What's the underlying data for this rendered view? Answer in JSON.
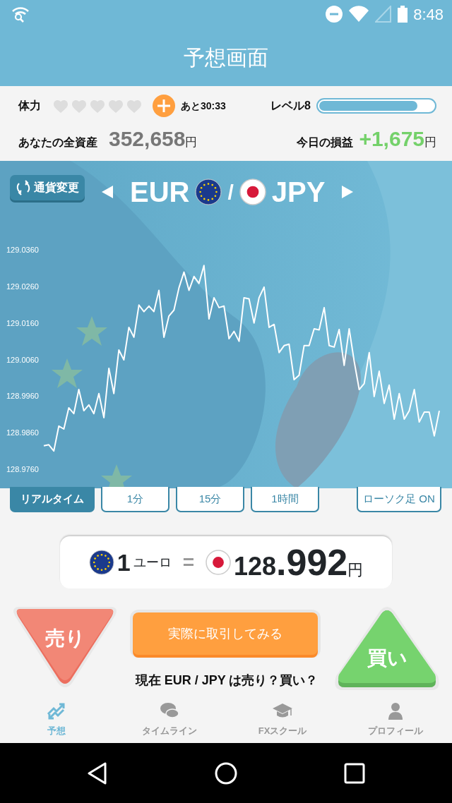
{
  "status_bar": {
    "time": "8:48"
  },
  "header": {
    "title": "予想画面"
  },
  "stamina": {
    "label": "体力",
    "stars": 0,
    "timer": "あと30:33"
  },
  "level": {
    "label": "レベル8",
    "level": 0.86
  },
  "assets": {
    "label": "あなたの全資産",
    "value": "352,658",
    "unit": "円"
  },
  "profit": {
    "label": "今日の損益",
    "value": "+1,675",
    "unit": "円"
  },
  "pair": {
    "change_button": "通貨変更",
    "base": "EUR",
    "separator": "/",
    "quote": "JPY"
  },
  "chart_data": {
    "type": "line",
    "ylim": [
      128.976,
      129.036
    ],
    "yticks": [
      {
        "value": 129.036,
        "label": "129.0360"
      },
      {
        "value": 129.026,
        "label": "129.0260"
      },
      {
        "value": 129.016,
        "label": "129.0160"
      },
      {
        "value": 129.006,
        "label": "129.0060"
      },
      {
        "value": 128.996,
        "label": "128.9960"
      },
      {
        "value": 128.986,
        "label": "128.9860"
      },
      {
        "value": 128.976,
        "label": "128.9760"
      }
    ],
    "series": [
      {
        "color": "#ffffff",
        "values": [
          128.9824,
          128.9827,
          128.981,
          128.9878,
          128.987,
          128.9928,
          128.9912,
          128.9978,
          128.992,
          128.9936,
          128.9912,
          128.9967,
          128.9901,
          129.0036,
          128.9967,
          129.0086,
          129.0059,
          129.0148,
          129.0121,
          129.0209,
          129.0191,
          129.0206,
          129.0191,
          129.0249,
          129.0121,
          129.0179,
          129.0195,
          129.0256,
          129.0299,
          129.0249,
          129.0287,
          129.0268,
          129.0317,
          129.0171,
          129.0229,
          129.0202,
          129.0206,
          129.0117,
          129.0137,
          129.011,
          129.0229,
          129.0226,
          129.016,
          129.0229,
          129.0258,
          129.0148,
          129.0156,
          129.0079,
          129.0098,
          129.0102,
          129.0005,
          129.0017,
          129.0098,
          129.0098,
          129.0144,
          129.0141,
          129.0202,
          129.0098,
          129.0094,
          129.0142,
          129.0044,
          129.0144,
          129.0055,
          128.9978,
          128.9994,
          129.0079,
          128.9959,
          129.0028,
          128.994,
          128.999,
          128.9897,
          128.9967,
          128.9897,
          128.992,
          128.9978,
          128.9889,
          128.9916,
          128.9916,
          128.9851,
          128.992
        ]
      }
    ]
  },
  "timeframes": [
    {
      "label": "リアルタイム",
      "selected": true
    },
    {
      "label": "1分",
      "selected": false
    },
    {
      "label": "15分",
      "selected": false
    },
    {
      "label": "1時間",
      "selected": false
    }
  ],
  "candle_toggle": "ローソク足 ON",
  "rate": {
    "amount": "1",
    "unit": "ユーロ",
    "equals": "=",
    "price_main": "128",
    "price_fraction": ".992",
    "price_unit": "円"
  },
  "actions": {
    "sell": "売り",
    "trade_button": "実際に取引してみる",
    "question": "現在 EUR / JPY は売り？買い？",
    "buy": "買い"
  },
  "nav": [
    {
      "kind": "trend",
      "label": "予想",
      "selected": true
    },
    {
      "kind": "chat",
      "label": "タイムライン",
      "selected": false
    },
    {
      "kind": "school",
      "label": "FXスクール",
      "selected": false
    },
    {
      "kind": "profile",
      "label": "プロフィール",
      "selected": false
    }
  ]
}
